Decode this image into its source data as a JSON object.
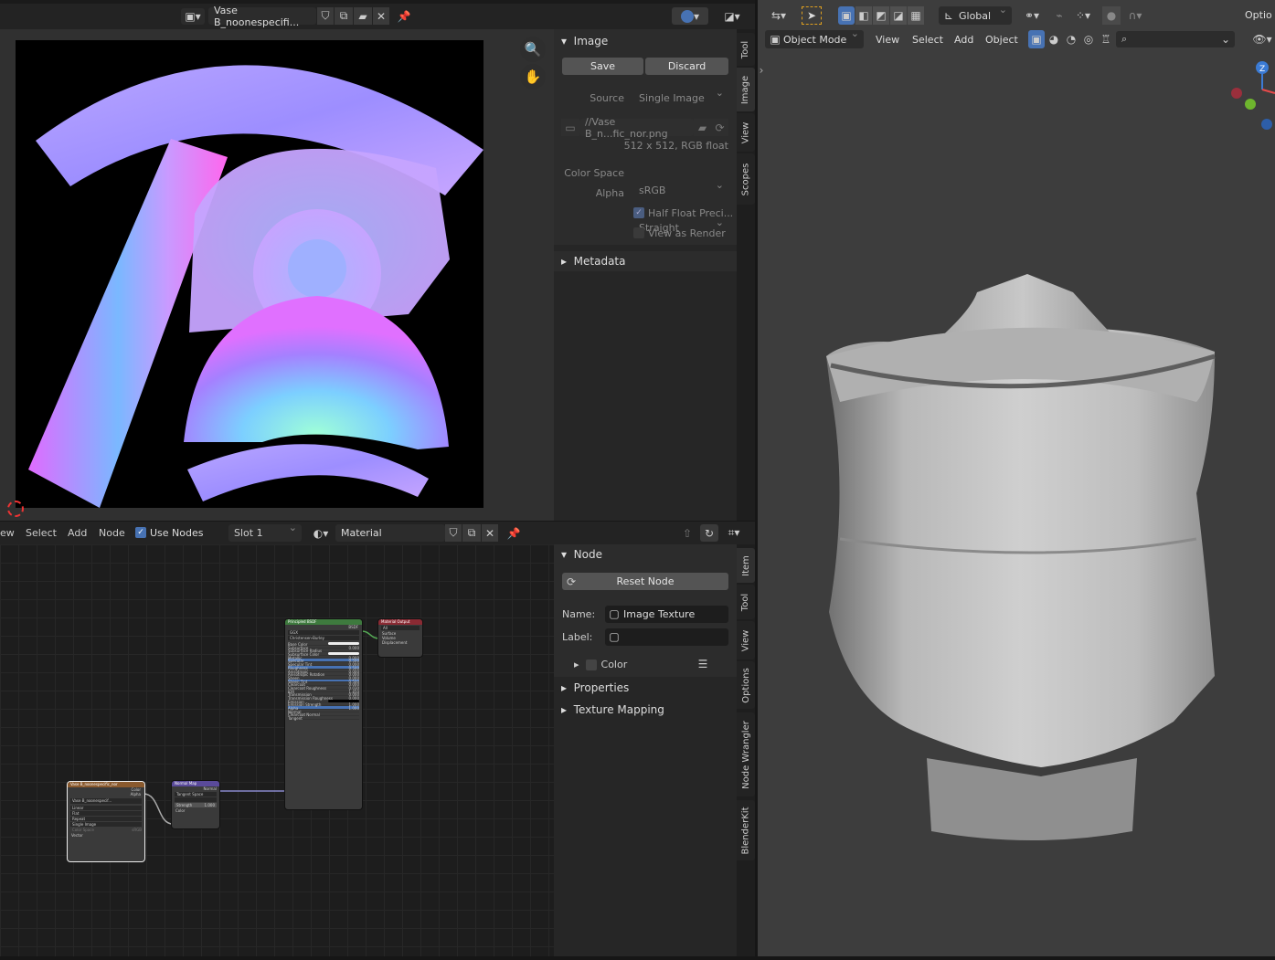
{
  "image_editor": {
    "image_name": "Vase B_noonespecifi...",
    "menu": []
  },
  "image_panel": {
    "title": "Image",
    "save": "Save",
    "discard": "Discard",
    "source_label": "Source",
    "source_value": "Single Image",
    "filepath": "//Vase B_n...fic_nor.png",
    "info": "512 x 512,  RGB float",
    "color_space_label": "Color Space",
    "color_space_value": "sRGB",
    "alpha_label": "Alpha",
    "alpha_value": "Straight",
    "half_float": "Half Float Preci...",
    "view_as_render": "View as Render",
    "metadata": "Metadata"
  },
  "image_tabs": [
    "Tool",
    "Image",
    "View",
    "Scopes"
  ],
  "node_header": {
    "menu": [
      "ew",
      "Select",
      "Add",
      "Node"
    ],
    "use_nodes": "Use Nodes",
    "slot": "Slot 1",
    "material": "Material"
  },
  "node_panel": {
    "title": "Node",
    "reset": "Reset Node",
    "name_label": "Name:",
    "name_value": "Image Texture",
    "label_label": "Label:",
    "color": "Color",
    "properties": "Properties",
    "texture_mapping": "Texture Mapping"
  },
  "node_tabs": [
    "Item",
    "Tool",
    "View",
    "Options",
    "Node Wrangler",
    "BlenderKit"
  ],
  "viewport": {
    "transform": "Global",
    "options": "Optio",
    "mode": "Object Mode",
    "menu": [
      "View",
      "Select",
      "Add",
      "Object"
    ]
  },
  "nodes": {
    "principled": {
      "title": "Principled BSDF",
      "out": "BSDF",
      "dist": "GGX",
      "ss": "Christensen-Burley",
      "rows": [
        [
          "Base Color",
          ""
        ],
        [
          "Subsurface",
          "0.000"
        ],
        [
          "Subsurface Radius",
          ""
        ],
        [
          "Subsurface Color",
          ""
        ],
        [
          "Metallic",
          "0.000"
        ],
        [
          "Specular",
          "0.500"
        ],
        [
          "Specular Tint",
          "0.000"
        ],
        [
          "Roughness",
          "0.500"
        ],
        [
          "Anisotropic",
          "0.000"
        ],
        [
          "Anisotropic Rotation",
          "0.000"
        ],
        [
          "Sheen",
          "0.000"
        ],
        [
          "Sheen Tint",
          "0.500"
        ],
        [
          "Clearcoat",
          "0.000"
        ],
        [
          "Clearcoat Roughness",
          "0.030"
        ],
        [
          "IOR",
          "1.450"
        ],
        [
          "Transmission",
          "0.000"
        ],
        [
          "Transmission Roughness",
          "0.000"
        ],
        [
          "Emission",
          ""
        ],
        [
          "Emission Strength",
          "1.000"
        ],
        [
          "Alpha",
          "1.000"
        ],
        [
          "Normal",
          ""
        ],
        [
          "Clearcoat Normal",
          ""
        ],
        [
          "Tangent",
          ""
        ]
      ]
    },
    "output": {
      "title": "Material Output",
      "target": "All",
      "rows": [
        "Surface",
        "Volume",
        "Displacement"
      ]
    },
    "normal": {
      "title": "Normal Map",
      "out": "Normal",
      "space": "Tangent Space",
      "strength": "Strength",
      "strength_val": "1.000",
      "color": "Color"
    },
    "texture": {
      "title": "Vase B_noonespecific_nor",
      "out1": "Color",
      "out2": "Alpha",
      "file": "Vase B_noonespecif...",
      "opts": [
        "Linear",
        "Flat",
        "Repeat",
        "Single Image"
      ],
      "cs": "Color Space",
      "cs_val": "sRGB",
      "vector": "Vector"
    }
  },
  "colors": {
    "accent": "#4772b3",
    "header": "#232323",
    "panel": "#2c2c2c",
    "viewport_bg": "#3d3d3d"
  }
}
